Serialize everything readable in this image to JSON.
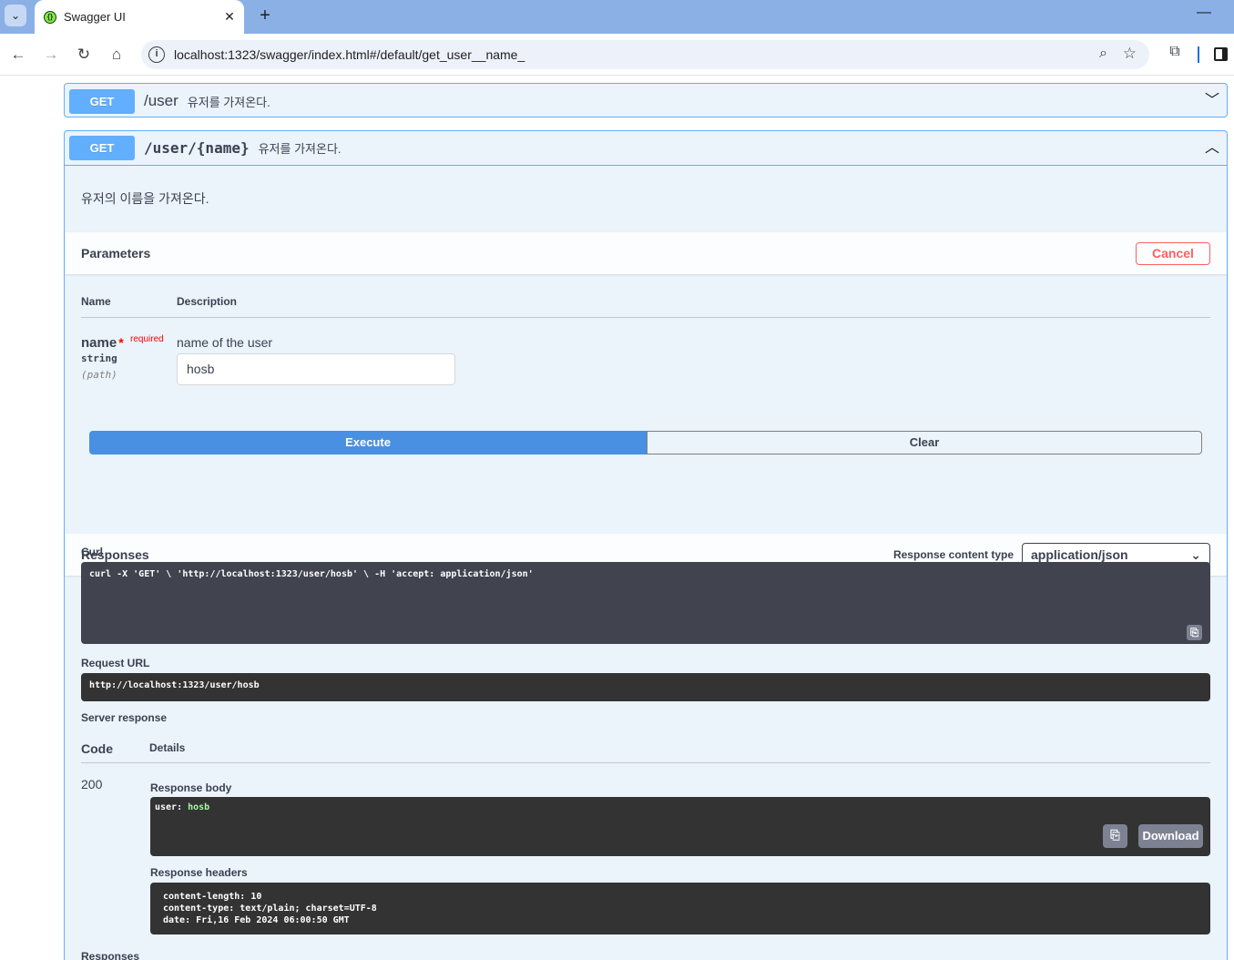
{
  "browser": {
    "tab_title": "Swagger UI",
    "tab_close": "✕",
    "new_tab": "+",
    "minimize": "—",
    "url": "localhost:1323/swagger/index.html#/default/get_user__name_"
  },
  "operations": [
    {
      "method": "GET",
      "path": "/user",
      "summary": "유저를 가져온다."
    },
    {
      "method": "GET",
      "path": "/user/{name}",
      "summary": "유저를 가져온다.",
      "description": "유저의 이름을 가져온다.",
      "parameters_title": "Parameters",
      "cancel_label": "Cancel",
      "table_headers": {
        "name": "Name",
        "description": "Description"
      },
      "parameter": {
        "name": "name",
        "required_star": "*",
        "required_text": "required",
        "type": "string",
        "in": "(path)",
        "description": "name of the user",
        "value": "hosb"
      },
      "execute_label": "Execute",
      "clear_label": "Clear",
      "responses_title": "Responses",
      "response_content_type_label": "Response content type",
      "response_content_type": "application/json",
      "curl_label": "Curl",
      "curl": "curl -X 'GET' \\ 'http://localhost:1323/user/hosb' \\ -H 'accept: application/json'",
      "request_url_label": "Request URL",
      "request_url": "http://localhost:1323/user/hosb",
      "server_response_label": "Server response",
      "code_header": "Code",
      "details_header": "Details",
      "status_code": "200",
      "response_body_label": "Response body",
      "response_body_key": "user: ",
      "response_body_value": "hosb",
      "download_label": "Download",
      "response_headers_label": "Response headers",
      "response_headers": [
        "content-length: 10",
        "content-type: text/plain; charset=UTF-8",
        "date: Fri,16 Feb 2024 06:00:50 GMT"
      ],
      "bottom_responses_label": "Responses"
    }
  ],
  "colors": {
    "get": "#61affe",
    "execute": "#4990e2",
    "cancel": "#ff6060",
    "code_bg": "#333333"
  }
}
